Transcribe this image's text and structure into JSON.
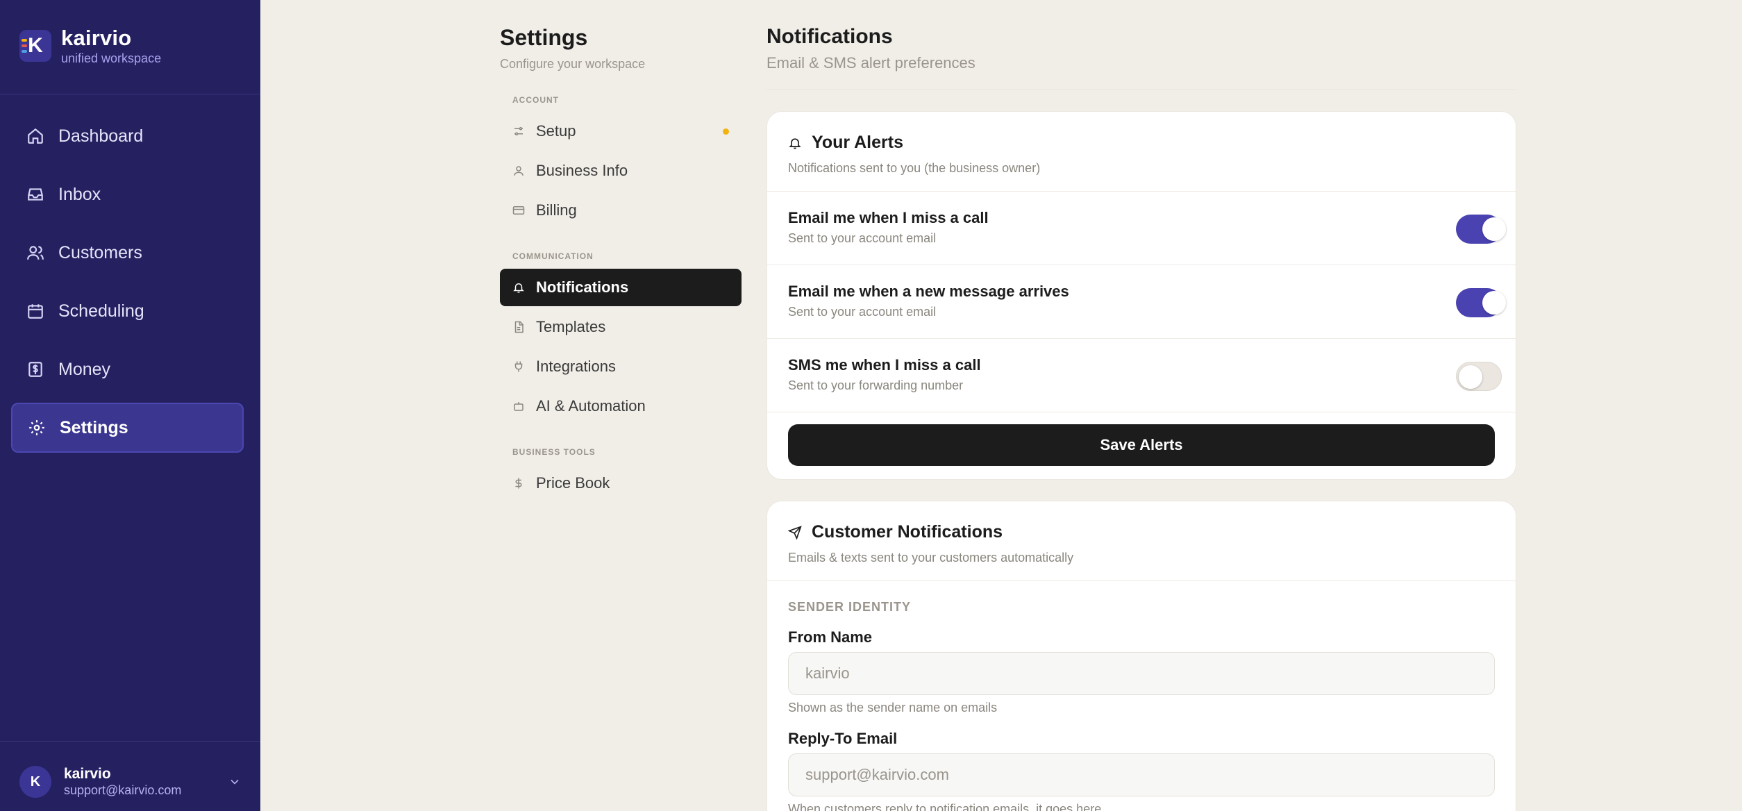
{
  "brand": {
    "name": "kairvio",
    "tagline": "unified workspace",
    "logo_letter": "K",
    "logo_colors": [
      "#f2b311",
      "#e2594f",
      "#4f9fe2"
    ]
  },
  "nav": {
    "items": [
      {
        "label": "Dashboard",
        "icon": "home-icon",
        "active": false
      },
      {
        "label": "Inbox",
        "icon": "inbox-icon",
        "active": false
      },
      {
        "label": "Customers",
        "icon": "users-icon",
        "active": false
      },
      {
        "label": "Scheduling",
        "icon": "calendar-icon",
        "active": false
      },
      {
        "label": "Money",
        "icon": "dollar-receipt-icon",
        "active": false
      },
      {
        "label": "Settings",
        "icon": "gear-icon",
        "active": true
      }
    ]
  },
  "account": {
    "initial": "K",
    "name": "kairvio",
    "email": "support@kairvio.com"
  },
  "settings": {
    "title": "Settings",
    "subtitle": "Configure your workspace",
    "sections": [
      {
        "label": "ACCOUNT",
        "items": [
          {
            "label": "Setup",
            "icon": "sliders-icon",
            "badge_dot": true
          },
          {
            "label": "Business Info",
            "icon": "user-icon"
          },
          {
            "label": "Billing",
            "icon": "credit-card-icon"
          }
        ]
      },
      {
        "label": "COMMUNICATION",
        "items": [
          {
            "label": "Notifications",
            "icon": "bell-icon",
            "active": true
          },
          {
            "label": "Templates",
            "icon": "file-icon"
          },
          {
            "label": "Integrations",
            "icon": "plug-icon"
          },
          {
            "label": "AI & Automation",
            "icon": "robot-icon"
          }
        ]
      },
      {
        "label": "BUSINESS TOOLS",
        "items": [
          {
            "label": "Price Book",
            "icon": "dollar-icon"
          }
        ]
      }
    ]
  },
  "main": {
    "title": "Notifications",
    "subtitle": "Email & SMS alert preferences",
    "alerts_card": {
      "title": "Your Alerts",
      "subtitle": "Notifications sent to you (the business owner)",
      "rows": [
        {
          "title": "Email me when I miss a call",
          "sub": "Sent to your account email",
          "enabled": true
        },
        {
          "title": "Email me when a new message arrives",
          "sub": "Sent to your account email",
          "enabled": true
        },
        {
          "title": "SMS me when I miss a call",
          "sub": "Sent to your forwarding number",
          "enabled": false
        }
      ],
      "save_label": "Save Alerts"
    },
    "customer_card": {
      "title": "Customer Notifications",
      "subtitle": "Emails & texts sent to your customers automatically",
      "section_label": "SENDER IDENTITY",
      "from_name": {
        "label": "From Name",
        "placeholder": "kairvio",
        "value": "",
        "help": "Shown as the sender name on emails"
      },
      "reply_to": {
        "label": "Reply-To Email",
        "placeholder": "support@kairvio.com",
        "value": "",
        "help": "When customers reply to notification emails, it goes here"
      }
    }
  },
  "colors": {
    "sidebar_bg": "#252060",
    "accent": "#4a42b0",
    "page_bg": "#f1eee8",
    "dark": "#1c1c1c",
    "badge": "#f2b311"
  }
}
